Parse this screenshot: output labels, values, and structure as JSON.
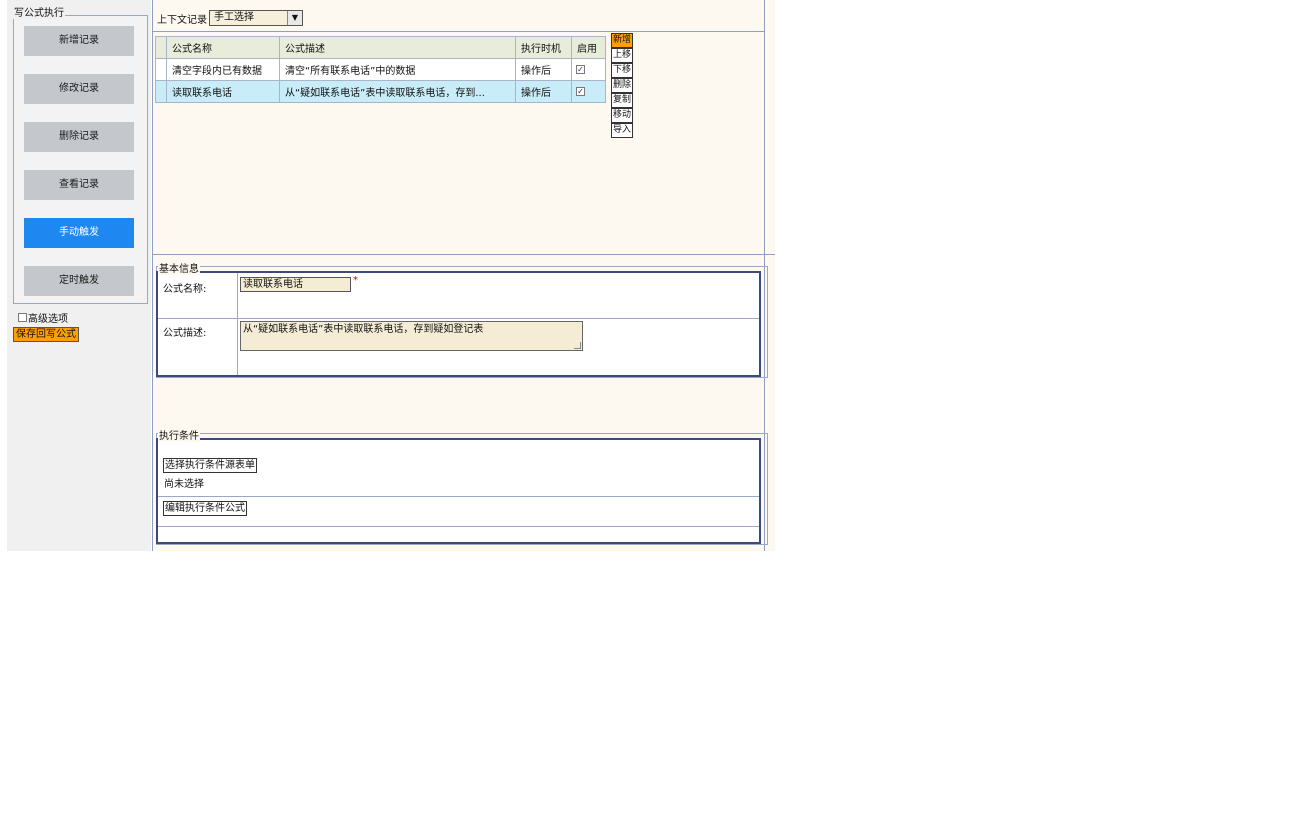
{
  "left_panel": {
    "group_title": "写公式执行",
    "trigger_buttons": [
      {
        "label": "新增记录",
        "active": false
      },
      {
        "label": "修改记录",
        "active": false
      },
      {
        "label": "删除记录",
        "active": false
      },
      {
        "label": "查看记录",
        "active": false
      },
      {
        "label": "手动触发",
        "active": true
      },
      {
        "label": "定时触发",
        "active": false
      }
    ],
    "advanced_label": "高级选项",
    "save_button": "保存回写公式"
  },
  "context": {
    "label": "上下文记录",
    "selected": "手工选择"
  },
  "formula_table": {
    "headers": [
      "公式名称",
      "公式描述",
      "执行时机",
      "启用"
    ],
    "rows": [
      {
        "name": "清空字段内已有数据",
        "desc": "清空“所有联系电话”中的数据",
        "timing": "操作后",
        "enabled": true,
        "selected": false
      },
      {
        "name": "读取联系电话",
        "desc": "从“疑如联系电话”表中读取联系电话，存到...",
        "timing": "操作后",
        "enabled": true,
        "selected": true
      }
    ]
  },
  "side_buttons": [
    "新增",
    "上移",
    "下移",
    "删除",
    "复制",
    "移动",
    "导入"
  ],
  "basic_info": {
    "title": "基本信息",
    "name_label": "公式名称:",
    "name_value": "读取联系电话",
    "required_mark": "*",
    "desc_label": "公式描述:",
    "desc_value": "从“疑如联系电话”表中读取联系电话，存到疑如登记表"
  },
  "exec_conditions": {
    "title": "执行条件",
    "select_source_button": "选择执行条件源表单",
    "not_selected_text": "尚未选择",
    "edit_formula_button": "编辑执行条件公式"
  },
  "colors": {
    "accent_blue": "#1e88f0",
    "orange": "#ffa000",
    "selected_row": "#c8ecf8"
  }
}
